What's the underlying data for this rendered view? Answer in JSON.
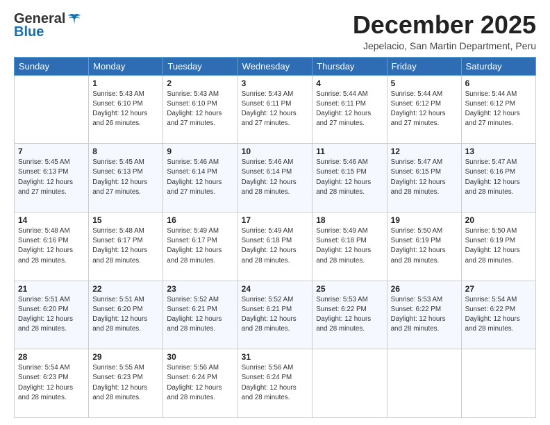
{
  "header": {
    "logo_general": "General",
    "logo_blue": "Blue",
    "month_title": "December 2025",
    "location": "Jepelacio, San Martin Department, Peru"
  },
  "weekdays": [
    "Sunday",
    "Monday",
    "Tuesday",
    "Wednesday",
    "Thursday",
    "Friday",
    "Saturday"
  ],
  "weeks": [
    [
      {
        "day": "",
        "sunrise": "",
        "sunset": "",
        "daylight": ""
      },
      {
        "day": "1",
        "sunrise": "Sunrise: 5:43 AM",
        "sunset": "Sunset: 6:10 PM",
        "daylight": "Daylight: 12 hours and 26 minutes."
      },
      {
        "day": "2",
        "sunrise": "Sunrise: 5:43 AM",
        "sunset": "Sunset: 6:10 PM",
        "daylight": "Daylight: 12 hours and 27 minutes."
      },
      {
        "day": "3",
        "sunrise": "Sunrise: 5:43 AM",
        "sunset": "Sunset: 6:11 PM",
        "daylight": "Daylight: 12 hours and 27 minutes."
      },
      {
        "day": "4",
        "sunrise": "Sunrise: 5:44 AM",
        "sunset": "Sunset: 6:11 PM",
        "daylight": "Daylight: 12 hours and 27 minutes."
      },
      {
        "day": "5",
        "sunrise": "Sunrise: 5:44 AM",
        "sunset": "Sunset: 6:12 PM",
        "daylight": "Daylight: 12 hours and 27 minutes."
      },
      {
        "day": "6",
        "sunrise": "Sunrise: 5:44 AM",
        "sunset": "Sunset: 6:12 PM",
        "daylight": "Daylight: 12 hours and 27 minutes."
      }
    ],
    [
      {
        "day": "7",
        "sunrise": "Sunrise: 5:45 AM",
        "sunset": "Sunset: 6:13 PM",
        "daylight": "Daylight: 12 hours and 27 minutes."
      },
      {
        "day": "8",
        "sunrise": "Sunrise: 5:45 AM",
        "sunset": "Sunset: 6:13 PM",
        "daylight": "Daylight: 12 hours and 27 minutes."
      },
      {
        "day": "9",
        "sunrise": "Sunrise: 5:46 AM",
        "sunset": "Sunset: 6:14 PM",
        "daylight": "Daylight: 12 hours and 27 minutes."
      },
      {
        "day": "10",
        "sunrise": "Sunrise: 5:46 AM",
        "sunset": "Sunset: 6:14 PM",
        "daylight": "Daylight: 12 hours and 28 minutes."
      },
      {
        "day": "11",
        "sunrise": "Sunrise: 5:46 AM",
        "sunset": "Sunset: 6:15 PM",
        "daylight": "Daylight: 12 hours and 28 minutes."
      },
      {
        "day": "12",
        "sunrise": "Sunrise: 5:47 AM",
        "sunset": "Sunset: 6:15 PM",
        "daylight": "Daylight: 12 hours and 28 minutes."
      },
      {
        "day": "13",
        "sunrise": "Sunrise: 5:47 AM",
        "sunset": "Sunset: 6:16 PM",
        "daylight": "Daylight: 12 hours and 28 minutes."
      }
    ],
    [
      {
        "day": "14",
        "sunrise": "Sunrise: 5:48 AM",
        "sunset": "Sunset: 6:16 PM",
        "daylight": "Daylight: 12 hours and 28 minutes."
      },
      {
        "day": "15",
        "sunrise": "Sunrise: 5:48 AM",
        "sunset": "Sunset: 6:17 PM",
        "daylight": "Daylight: 12 hours and 28 minutes."
      },
      {
        "day": "16",
        "sunrise": "Sunrise: 5:49 AM",
        "sunset": "Sunset: 6:17 PM",
        "daylight": "Daylight: 12 hours and 28 minutes."
      },
      {
        "day": "17",
        "sunrise": "Sunrise: 5:49 AM",
        "sunset": "Sunset: 6:18 PM",
        "daylight": "Daylight: 12 hours and 28 minutes."
      },
      {
        "day": "18",
        "sunrise": "Sunrise: 5:49 AM",
        "sunset": "Sunset: 6:18 PM",
        "daylight": "Daylight: 12 hours and 28 minutes."
      },
      {
        "day": "19",
        "sunrise": "Sunrise: 5:50 AM",
        "sunset": "Sunset: 6:19 PM",
        "daylight": "Daylight: 12 hours and 28 minutes."
      },
      {
        "day": "20",
        "sunrise": "Sunrise: 5:50 AM",
        "sunset": "Sunset: 6:19 PM",
        "daylight": "Daylight: 12 hours and 28 minutes."
      }
    ],
    [
      {
        "day": "21",
        "sunrise": "Sunrise: 5:51 AM",
        "sunset": "Sunset: 6:20 PM",
        "daylight": "Daylight: 12 hours and 28 minutes."
      },
      {
        "day": "22",
        "sunrise": "Sunrise: 5:51 AM",
        "sunset": "Sunset: 6:20 PM",
        "daylight": "Daylight: 12 hours and 28 minutes."
      },
      {
        "day": "23",
        "sunrise": "Sunrise: 5:52 AM",
        "sunset": "Sunset: 6:21 PM",
        "daylight": "Daylight: 12 hours and 28 minutes."
      },
      {
        "day": "24",
        "sunrise": "Sunrise: 5:52 AM",
        "sunset": "Sunset: 6:21 PM",
        "daylight": "Daylight: 12 hours and 28 minutes."
      },
      {
        "day": "25",
        "sunrise": "Sunrise: 5:53 AM",
        "sunset": "Sunset: 6:22 PM",
        "daylight": "Daylight: 12 hours and 28 minutes."
      },
      {
        "day": "26",
        "sunrise": "Sunrise: 5:53 AM",
        "sunset": "Sunset: 6:22 PM",
        "daylight": "Daylight: 12 hours and 28 minutes."
      },
      {
        "day": "27",
        "sunrise": "Sunrise: 5:54 AM",
        "sunset": "Sunset: 6:22 PM",
        "daylight": "Daylight: 12 hours and 28 minutes."
      }
    ],
    [
      {
        "day": "28",
        "sunrise": "Sunrise: 5:54 AM",
        "sunset": "Sunset: 6:23 PM",
        "daylight": "Daylight: 12 hours and 28 minutes."
      },
      {
        "day": "29",
        "sunrise": "Sunrise: 5:55 AM",
        "sunset": "Sunset: 6:23 PM",
        "daylight": "Daylight: 12 hours and 28 minutes."
      },
      {
        "day": "30",
        "sunrise": "Sunrise: 5:56 AM",
        "sunset": "Sunset: 6:24 PM",
        "daylight": "Daylight: 12 hours and 28 minutes."
      },
      {
        "day": "31",
        "sunrise": "Sunrise: 5:56 AM",
        "sunset": "Sunset: 6:24 PM",
        "daylight": "Daylight: 12 hours and 28 minutes."
      },
      {
        "day": "",
        "sunrise": "",
        "sunset": "",
        "daylight": ""
      },
      {
        "day": "",
        "sunrise": "",
        "sunset": "",
        "daylight": ""
      },
      {
        "day": "",
        "sunrise": "",
        "sunset": "",
        "daylight": ""
      }
    ]
  ]
}
